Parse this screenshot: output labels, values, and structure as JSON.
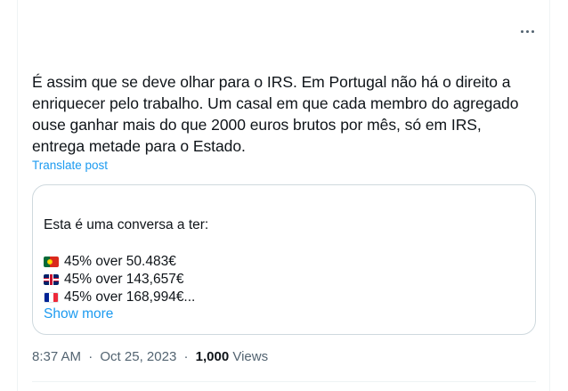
{
  "post": {
    "text": "É assim que se deve olhar para o IRS. Em Portugal não há o direito a\nenriquecer pelo trabalho. Um casal em que cada membro do agregado\nouse ganhar mais do que 2000 euros brutos por mês, só em IRS,\nentrega metade para o Estado.",
    "translate_label": "Translate post",
    "more_icon": "more-horizontal-icon"
  },
  "quote": {
    "intro": "Esta é uma conversa a ter:",
    "lines": [
      {
        "flag": "portugal-flag-icon",
        "text": "45% over 50.483€"
      },
      {
        "flag": "uk-flag-icon",
        "text": "45% over 143,657€"
      },
      {
        "flag": "france-flag-icon",
        "text": "45% over 168,994€..."
      }
    ],
    "show_more_label": "Show more"
  },
  "meta": {
    "time": "8:37 AM",
    "separator": "·",
    "date": "Oct 25, 2023",
    "views_count": "1,000",
    "views_label": "Views"
  },
  "colors": {
    "accent": "#1d9bf0",
    "text": "#0f1419",
    "secondary": "#536471",
    "border": "#cfd9de"
  }
}
